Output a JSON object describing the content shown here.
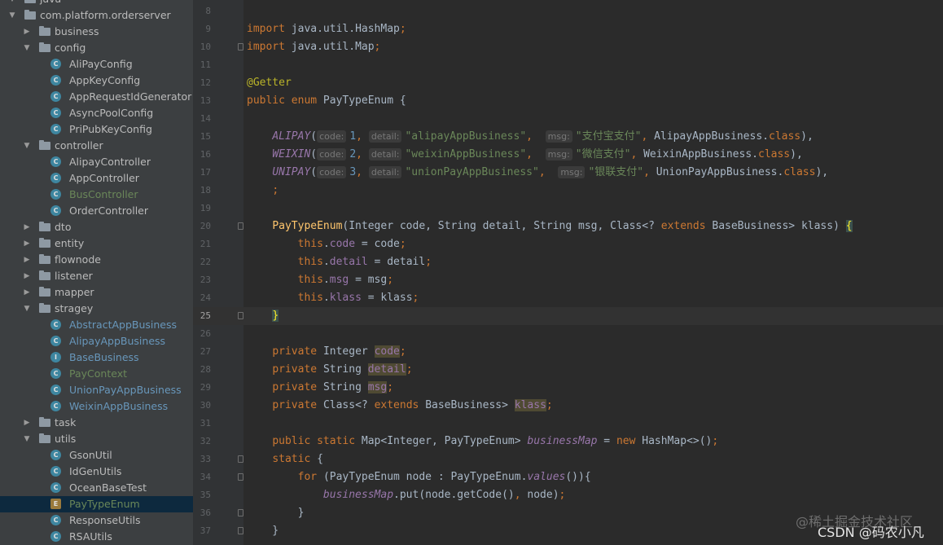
{
  "project_tree": [
    {
      "label": "java",
      "kind": "folder",
      "depth": 0,
      "expanded": true
    },
    {
      "label": "com.platform.orderserver",
      "kind": "folder",
      "depth": 0,
      "expanded": true
    },
    {
      "label": "business",
      "kind": "folder",
      "depth": 1,
      "expanded": false
    },
    {
      "label": "config",
      "kind": "folder",
      "depth": 1,
      "expanded": true
    },
    {
      "label": "AliPayConfig",
      "kind": "class",
      "depth": 2
    },
    {
      "label": "AppKeyConfig",
      "kind": "class",
      "depth": 2
    },
    {
      "label": "AppRequestIdGenerator",
      "kind": "class",
      "depth": 2
    },
    {
      "label": "AsyncPoolConfig",
      "kind": "class",
      "depth": 2
    },
    {
      "label": "PriPubKeyConfig",
      "kind": "class",
      "depth": 2
    },
    {
      "label": "controller",
      "kind": "folder",
      "depth": 1,
      "expanded": true
    },
    {
      "label": "AlipayController",
      "kind": "class",
      "depth": 2
    },
    {
      "label": "AppController",
      "kind": "class",
      "depth": 2
    },
    {
      "label": "BusController",
      "kind": "class",
      "depth": 2,
      "color": "#6a8759"
    },
    {
      "label": "OrderController",
      "kind": "class",
      "depth": 2
    },
    {
      "label": "dto",
      "kind": "folder",
      "depth": 1,
      "expanded": false
    },
    {
      "label": "entity",
      "kind": "folder",
      "depth": 1,
      "expanded": false
    },
    {
      "label": "flownode",
      "kind": "folder",
      "depth": 1,
      "expanded": false
    },
    {
      "label": "listener",
      "kind": "folder",
      "depth": 1,
      "expanded": false
    },
    {
      "label": "mapper",
      "kind": "folder",
      "depth": 1,
      "expanded": false
    },
    {
      "label": "stragey",
      "kind": "folder",
      "depth": 1,
      "expanded": true
    },
    {
      "label": "AbstractAppBusiness",
      "kind": "abstract",
      "depth": 2,
      "color": "#6897bb"
    },
    {
      "label": "AlipayAppBusiness",
      "kind": "class",
      "depth": 2,
      "color": "#6897bb"
    },
    {
      "label": "BaseBusiness",
      "kind": "interface",
      "depth": 2,
      "color": "#6897bb"
    },
    {
      "label": "PayContext",
      "kind": "class",
      "depth": 2,
      "color": "#6a8759"
    },
    {
      "label": "UnionPayAppBusiness",
      "kind": "class",
      "depth": 2,
      "color": "#6897bb"
    },
    {
      "label": "WeixinAppBusiness",
      "kind": "class",
      "depth": 2,
      "color": "#6897bb"
    },
    {
      "label": "task",
      "kind": "folder",
      "depth": 1,
      "expanded": false
    },
    {
      "label": "utils",
      "kind": "folder",
      "depth": 1,
      "expanded": true
    },
    {
      "label": "GsonUtil",
      "kind": "class",
      "depth": 2
    },
    {
      "label": "IdGenUtils",
      "kind": "class",
      "depth": 2
    },
    {
      "label": "OceanBaseTest",
      "kind": "class",
      "depth": 2
    },
    {
      "label": "PayTypeEnum",
      "kind": "enum",
      "depth": 2,
      "selected": true,
      "color": "#6a8759"
    },
    {
      "label": "ResponseUtils",
      "kind": "class",
      "depth": 2
    },
    {
      "label": "RSAUtils",
      "kind": "class",
      "depth": 2
    }
  ],
  "editor": {
    "current_line": 25,
    "lines": [
      {
        "n": "8",
        "fold": false,
        "t": []
      },
      {
        "n": "9",
        "fold": false,
        "t": [
          [
            "kw",
            "import "
          ],
          [
            "",
            "java.util.HashMap"
          ],
          [
            "kw",
            ";"
          ]
        ]
      },
      {
        "n": "10",
        "fold": true,
        "t": [
          [
            "kw",
            "import "
          ],
          [
            "",
            "java.util.Map"
          ],
          [
            "kw",
            ";"
          ]
        ]
      },
      {
        "n": "11",
        "fold": false,
        "t": []
      },
      {
        "n": "12",
        "fold": false,
        "t": [
          [
            "an",
            "@Getter"
          ]
        ]
      },
      {
        "n": "13",
        "fold": false,
        "t": [
          [
            "kw",
            "public enum "
          ],
          [
            "",
            "PayTypeEnum {"
          ]
        ]
      },
      {
        "n": "14",
        "fold": false,
        "t": []
      },
      {
        "n": "15",
        "fold": false,
        "t": [
          [
            "",
            "    "
          ],
          [
            "cn",
            "ALIPAY"
          ],
          [
            "",
            "("
          ],
          [
            "hint",
            "code:"
          ],
          [
            "nu",
            "1"
          ],
          [
            "kw",
            ", "
          ],
          [
            "hint",
            "detail:"
          ],
          [
            "st",
            "\"alipayAppBusiness\""
          ],
          [
            "kw",
            ",  "
          ],
          [
            "hint",
            "msg:"
          ],
          [
            "st",
            "\"支付宝支付\""
          ],
          [
            "kw",
            ", "
          ],
          [
            "",
            "AlipayAppBusiness."
          ],
          [
            "kw",
            "class"
          ],
          [
            "",
            "),"
          ]
        ]
      },
      {
        "n": "16",
        "fold": false,
        "t": [
          [
            "",
            "    "
          ],
          [
            "cn",
            "WEIXIN"
          ],
          [
            "",
            "("
          ],
          [
            "hint",
            "code:"
          ],
          [
            "nu",
            "2"
          ],
          [
            "kw",
            ", "
          ],
          [
            "hint",
            "detail:"
          ],
          [
            "st",
            "\"weixinAppBusiness\""
          ],
          [
            "kw",
            ",  "
          ],
          [
            "hint",
            "msg:"
          ],
          [
            "st",
            "\"微信支付\""
          ],
          [
            "kw",
            ", "
          ],
          [
            "",
            "WeixinAppBusiness."
          ],
          [
            "kw",
            "class"
          ],
          [
            "",
            "),"
          ]
        ]
      },
      {
        "n": "17",
        "fold": false,
        "t": [
          [
            "",
            "    "
          ],
          [
            "cn",
            "UNIPAY"
          ],
          [
            "",
            "("
          ],
          [
            "hint",
            "code:"
          ],
          [
            "nu",
            "3"
          ],
          [
            "kw",
            ", "
          ],
          [
            "hint",
            "detail:"
          ],
          [
            "st",
            "\"unionPayAppBusiness\""
          ],
          [
            "kw",
            ",  "
          ],
          [
            "hint",
            "msg:"
          ],
          [
            "st",
            "\"银联支付\""
          ],
          [
            "kw",
            ", "
          ],
          [
            "",
            "UnionPayAppBusiness."
          ],
          [
            "kw",
            "class"
          ],
          [
            "",
            "),"
          ]
        ]
      },
      {
        "n": "18",
        "fold": false,
        "t": [
          [
            "",
            "    "
          ],
          [
            "kw",
            ";"
          ]
        ]
      },
      {
        "n": "19",
        "fold": false,
        "t": []
      },
      {
        "n": "20",
        "fold": true,
        "t": [
          [
            "",
            "    "
          ],
          [
            "fn",
            "PayTypeEnum"
          ],
          [
            "",
            "(Integer code, String detail, String msg, Class<? "
          ],
          [
            "kw",
            "extends "
          ],
          [
            "",
            "BaseBusiness> klass) "
          ],
          [
            "brace",
            "{"
          ]
        ]
      },
      {
        "n": "21",
        "fold": false,
        "t": [
          [
            "",
            "        "
          ],
          [
            "kw",
            "this"
          ],
          [
            "",
            "."
          ],
          [
            "fd",
            "code"
          ],
          [
            "",
            " = code"
          ],
          [
            "kw",
            ";"
          ]
        ]
      },
      {
        "n": "22",
        "fold": false,
        "t": [
          [
            "",
            "        "
          ],
          [
            "kw",
            "this"
          ],
          [
            "",
            "."
          ],
          [
            "fd",
            "detail"
          ],
          [
            "",
            " = detail"
          ],
          [
            "kw",
            ";"
          ]
        ]
      },
      {
        "n": "23",
        "fold": false,
        "t": [
          [
            "",
            "        "
          ],
          [
            "kw",
            "this"
          ],
          [
            "",
            "."
          ],
          [
            "fd",
            "msg"
          ],
          [
            "",
            " = msg"
          ],
          [
            "kw",
            ";"
          ]
        ]
      },
      {
        "n": "24",
        "fold": false,
        "t": [
          [
            "",
            "        "
          ],
          [
            "kw",
            "this"
          ],
          [
            "",
            "."
          ],
          [
            "fd",
            "klass"
          ],
          [
            "",
            " = klass"
          ],
          [
            "kw",
            ";"
          ]
        ]
      },
      {
        "n": "25",
        "fold": true,
        "t": [
          [
            "",
            "    "
          ],
          [
            "brace",
            "}"
          ]
        ]
      },
      {
        "n": "26",
        "fold": false,
        "t": []
      },
      {
        "n": "27",
        "fold": false,
        "t": [
          [
            "",
            "    "
          ],
          [
            "kw",
            "private "
          ],
          [
            "",
            "Integer "
          ],
          [
            "hlfd",
            "code"
          ],
          [
            "kw",
            ";"
          ]
        ]
      },
      {
        "n": "28",
        "fold": false,
        "t": [
          [
            "",
            "    "
          ],
          [
            "kw",
            "private "
          ],
          [
            "",
            "String "
          ],
          [
            "hlfd",
            "detail"
          ],
          [
            "kw",
            ";"
          ]
        ]
      },
      {
        "n": "29",
        "fold": false,
        "t": [
          [
            "",
            "    "
          ],
          [
            "kw",
            "private "
          ],
          [
            "",
            "String "
          ],
          [
            "hlfd",
            "msg"
          ],
          [
            "kw",
            ";"
          ]
        ]
      },
      {
        "n": "30",
        "fold": false,
        "t": [
          [
            "",
            "    "
          ],
          [
            "kw",
            "private "
          ],
          [
            "",
            "Class<? "
          ],
          [
            "kw",
            "extends "
          ],
          [
            "",
            "BaseBusiness> "
          ],
          [
            "hlfd",
            "klass"
          ],
          [
            "kw",
            ";"
          ]
        ]
      },
      {
        "n": "31",
        "fold": false,
        "t": []
      },
      {
        "n": "32",
        "fold": false,
        "t": [
          [
            "",
            "    "
          ],
          [
            "kw",
            "public static "
          ],
          [
            "",
            "Map<Integer, PayTypeEnum> "
          ],
          [
            "cn",
            "businessMap"
          ],
          [
            "",
            " = "
          ],
          [
            "kw",
            "new "
          ],
          [
            "",
            "HashMap<>()"
          ],
          [
            "kw",
            ";"
          ]
        ]
      },
      {
        "n": "33",
        "fold": true,
        "t": [
          [
            "",
            "    "
          ],
          [
            "kw",
            "static "
          ],
          [
            "",
            "{"
          ]
        ]
      },
      {
        "n": "34",
        "fold": true,
        "t": [
          [
            "",
            "        "
          ],
          [
            "kw",
            "for "
          ],
          [
            "",
            "(PayTypeEnum node : PayTypeEnum."
          ],
          [
            "cn",
            "values"
          ],
          [
            "",
            "()){"
          ]
        ]
      },
      {
        "n": "35",
        "fold": false,
        "t": [
          [
            "",
            "            "
          ],
          [
            "cn",
            "businessMap"
          ],
          [
            "",
            ".put(node.getCode()"
          ],
          [
            "kw",
            ", "
          ],
          [
            "",
            "node)"
          ],
          [
            "kw",
            ";"
          ]
        ]
      },
      {
        "n": "36",
        "fold": true,
        "t": [
          [
            "",
            "        }"
          ]
        ]
      },
      {
        "n": "37",
        "fold": true,
        "t": [
          [
            "",
            "    }"
          ]
        ]
      }
    ]
  },
  "watermarks": [
    "@稀土掘金技术社区",
    "CSDN @码农小凡"
  ]
}
